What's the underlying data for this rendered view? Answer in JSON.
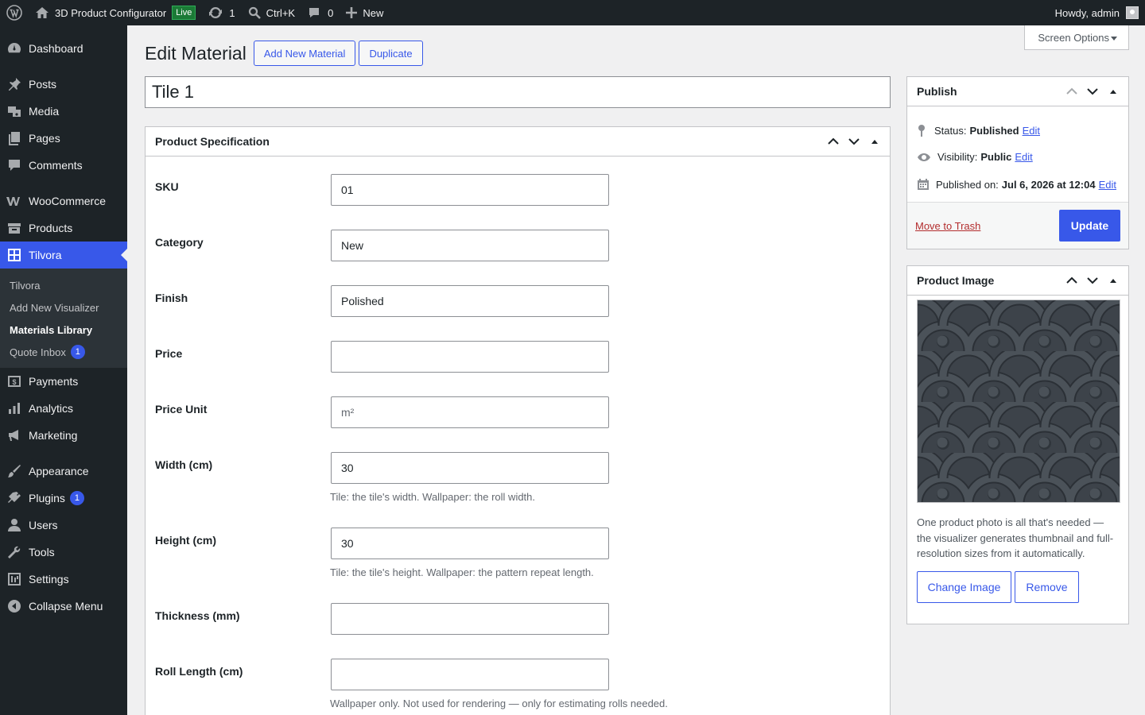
{
  "adminbar": {
    "site_name": "3D Product Configurator",
    "live_badge": "Live",
    "updates_count": "1",
    "search_shortcut": "Ctrl+K",
    "comments_count": "0",
    "new_label": "New",
    "howdy": "Howdy, admin"
  },
  "sidebar": {
    "items": [
      {
        "label": "Dashboard",
        "icon": "dashboard-icon"
      },
      {
        "label": "Posts",
        "icon": "pin-icon"
      },
      {
        "label": "Media",
        "icon": "media-icon"
      },
      {
        "label": "Pages",
        "icon": "pages-icon"
      },
      {
        "label": "Comments",
        "icon": "comment-icon"
      },
      {
        "label": "WooCommerce",
        "icon": "woocommerce-icon"
      },
      {
        "label": "Products",
        "icon": "products-icon"
      },
      {
        "label": "Tilvora",
        "icon": "grid-icon"
      },
      {
        "label": "Payments",
        "icon": "payments-icon"
      },
      {
        "label": "Analytics",
        "icon": "analytics-icon"
      },
      {
        "label": "Marketing",
        "icon": "megaphone-icon"
      },
      {
        "label": "Appearance",
        "icon": "brush-icon"
      },
      {
        "label": "Plugins",
        "icon": "plug-icon",
        "badge": "1"
      },
      {
        "label": "Users",
        "icon": "user-icon"
      },
      {
        "label": "Tools",
        "icon": "wrench-icon"
      },
      {
        "label": "Settings",
        "icon": "settings-icon"
      },
      {
        "label": "Collapse Menu",
        "icon": "collapse-icon"
      }
    ],
    "submenu": [
      {
        "label": "Tilvora"
      },
      {
        "label": "Add New Visualizer"
      },
      {
        "label": "Materials Library"
      },
      {
        "label": "Quote Inbox",
        "badge": "1"
      }
    ]
  },
  "screen_options": "Screen Options",
  "page": {
    "title": "Edit Material",
    "add_new": "Add New Material",
    "duplicate": "Duplicate",
    "post_title": "Tile 1"
  },
  "spec": {
    "title": "Product Specification",
    "fields": [
      {
        "label": "SKU",
        "value": "01"
      },
      {
        "label": "Category",
        "value": "New"
      },
      {
        "label": "Finish",
        "value": "Polished"
      },
      {
        "label": "Price",
        "value": ""
      },
      {
        "label": "Price Unit",
        "placeholder": "m²"
      },
      {
        "label": "Width (cm)",
        "value": "30",
        "desc": "Tile: the tile's width. Wallpaper: the roll width."
      },
      {
        "label": "Height (cm)",
        "value": "30",
        "desc": "Tile: the tile's height. Wallpaper: the pattern repeat length."
      },
      {
        "label": "Thickness (mm)",
        "value": ""
      },
      {
        "label": "Roll Length (cm)",
        "value": "",
        "desc": "Wallpaper only. Not used for rendering — only for estimating rolls needed."
      }
    ]
  },
  "publish": {
    "title": "Publish",
    "status_label": "Status:",
    "status_value": "Published",
    "visibility_label": "Visibility:",
    "visibility_value": "Public",
    "published_label": "Published on:",
    "published_value": "Jul 6, 2026 at 12:04",
    "edit": "Edit",
    "trash": "Move to Trash",
    "update": "Update"
  },
  "product_image": {
    "title": "Product Image",
    "desc": "One product photo is all that's needed — the visualizer generates thumbnail and full-resolution sizes from it automatically.",
    "change": "Change Image",
    "remove": "Remove"
  }
}
